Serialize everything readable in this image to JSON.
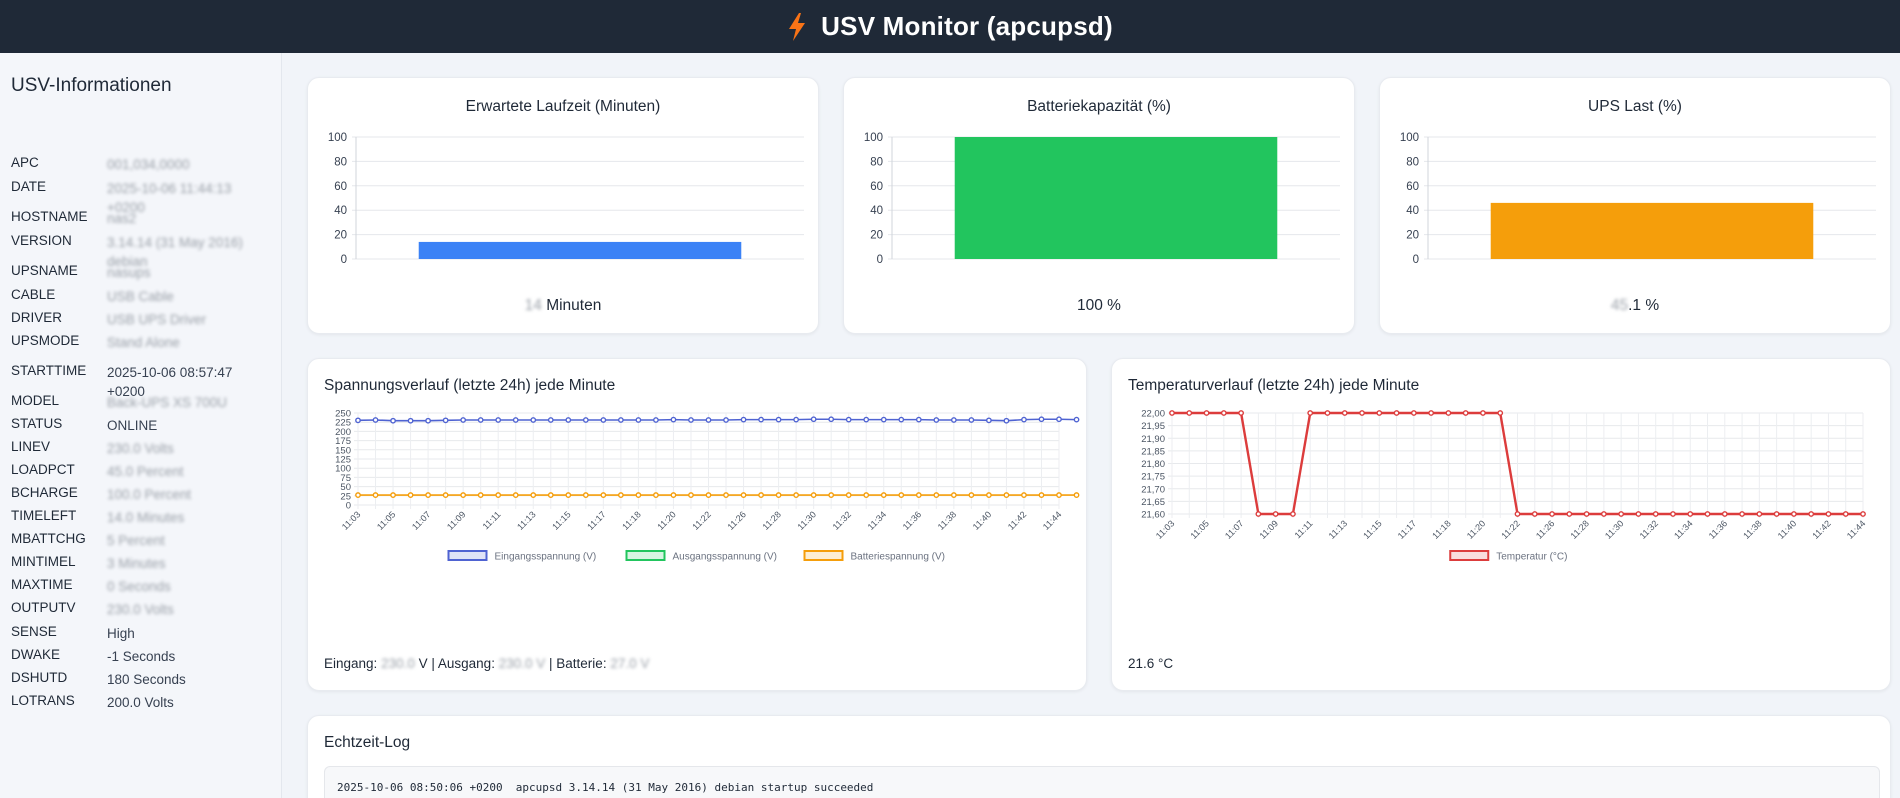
{
  "header": {
    "title": "USV Monitor (apcupsd)",
    "icon": "lightning-bolt-icon",
    "accent": "#f97316"
  },
  "sidebar": {
    "title": "USV-Informationen",
    "rows": [
      {
        "key": "APC",
        "value": "001,034,0000"
      },
      {
        "key": "DATE",
        "value": "2025-10-06 11:44:13 +0200",
        "blurred": true
      },
      {
        "key": "HOSTNAME",
        "value": "nas2"
      },
      {
        "key": "VERSION",
        "value": "3.14.14 (31 May 2016) debian",
        "blurred": true
      },
      {
        "key": "UPSNAME",
        "value": "nasups"
      },
      {
        "key": "CABLE",
        "value": "USB Cable"
      },
      {
        "key": "DRIVER",
        "value": "USB UPS Driver"
      },
      {
        "key": "UPSMODE",
        "value": "Stand Alone"
      },
      {
        "key": "STARTTIME",
        "value": "2025-10-06 08:57:47 +0200",
        "blurred": false
      },
      {
        "key": "MODEL",
        "value": "Back-UPS XS 700U"
      },
      {
        "key": "STATUS",
        "value": "ONLINE"
      },
      {
        "key": "LINEV",
        "value": "230.0 Volts"
      },
      {
        "key": "LOADPCT",
        "value": "45.0 Percent"
      },
      {
        "key": "BCHARGE",
        "value": "100.0 Percent"
      },
      {
        "key": "TIMELEFT",
        "value": "14.0 Minutes"
      },
      {
        "key": "MBATTCHG",
        "value": "5 Percent"
      },
      {
        "key": "MINTIMEL",
        "value": "3 Minutes"
      },
      {
        "key": "MAXTIME",
        "value": "0 Seconds"
      },
      {
        "key": "OUTPUTV",
        "value": "230.0 Volts"
      },
      {
        "key": "SENSE",
        "value": "High"
      },
      {
        "key": "DWAKE",
        "value": "-1 Seconds"
      },
      {
        "key": "DSHUTD",
        "value": "180 Seconds"
      },
      {
        "key": "LOTRANS",
        "value": "200.0 Volts"
      }
    ]
  },
  "cards": {
    "runtime": {
      "title": "Erwartete Laufzeit (Minuten)",
      "value_num": "14",
      "value_unit": "Minuten",
      "color": "#3b82f6"
    },
    "battery": {
      "title": "Batteriekapazität (%)",
      "value_text": "100 %",
      "color": "#22c55e"
    },
    "load": {
      "title": "UPS Last (%)",
      "value_num": "45",
      "value_unit": ".1 %",
      "color": "#f59e0b"
    },
    "voltage": {
      "title": "Spannungsverlauf (letzte 24h) jede Minute",
      "footer_prefix": "Eingang:",
      "eingang": "230.0",
      "footer_v": "V | Ausgang:",
      "ausgang": "230.0 V",
      "footer_b": "| Batterie:",
      "batterie": "27.0 V"
    },
    "temperature": {
      "title": "Temperaturverlauf (letzte 24h) jede Minute",
      "footer": "21.6 °C"
    },
    "log": {
      "title": "Echtzeit-Log",
      "line1": "2025-10-06 08:50:06 +0200  apcupsd 3.14.14 (31 May 2016) debian startup succeeded"
    }
  },
  "chart_data": [
    {
      "type": "bar",
      "categories": [
        ""
      ],
      "values": [
        14
      ],
      "title": "Erwartete Laufzeit (Minuten)",
      "ylim": [
        0,
        100
      ],
      "yticks": [
        "0",
        "20",
        "40",
        "60",
        "80",
        "100"
      ],
      "color": "#3b82f6"
    },
    {
      "type": "bar",
      "categories": [
        ""
      ],
      "values": [
        100
      ],
      "title": "Batteriekapazität (%)",
      "ylim": [
        0,
        100
      ],
      "yticks": [
        "0",
        "20",
        "40",
        "60",
        "80",
        "100"
      ],
      "color": "#22c55e"
    },
    {
      "type": "bar",
      "categories": [
        ""
      ],
      "values": [
        46
      ],
      "title": "UPS Last (%)",
      "ylim": [
        0,
        100
      ],
      "yticks": [
        "0",
        "20",
        "40",
        "60",
        "80",
        "100"
      ],
      "color": "#f59e0b"
    },
    {
      "type": "line",
      "title": "Spannungsverlauf (letzte 24h) jede Minute",
      "x": [
        "11:03",
        "11:04",
        "11:05",
        "11:06",
        "11:07",
        "11:08",
        "11:09",
        "11:10",
        "11:11",
        "11:12",
        "11:13",
        "11:14",
        "11:15",
        "11:16",
        "11:17",
        "11:18",
        "11:18",
        "11:19",
        "11:20",
        "11:21",
        "11:22",
        "11:23",
        "11:26",
        "11:27",
        "11:28",
        "11:29",
        "11:30",
        "11:31",
        "11:32",
        "11:33",
        "11:34",
        "11:35",
        "11:36",
        "11:37",
        "11:38",
        "11:39",
        "11:40",
        "11:41",
        "11:42",
        "11:43",
        "11:44"
      ],
      "xticks": [
        "11:03",
        "11:05",
        "11:07",
        "11:09",
        "11:11",
        "11:13",
        "11:15",
        "11:17",
        "11:18",
        "11:20",
        "11:22",
        "11:26",
        "11:28",
        "11:30",
        "11:32",
        "11:34",
        "11:36",
        "11:38",
        "11:40",
        "11:42",
        "11:44"
      ],
      "ylim": [
        0,
        250
      ],
      "yticks": [
        "0",
        "25",
        "50",
        "75",
        "100",
        "125",
        "150",
        "175",
        "200",
        "225",
        "250"
      ],
      "series": [
        {
          "name": "Eingangsspannung (V)",
          "color": "#4f63d2",
          "values": [
            230,
            231,
            229,
            229,
            229,
            230,
            231,
            231,
            231,
            231,
            231,
            231,
            231,
            231,
            231,
            231,
            231,
            231,
            232,
            231,
            231,
            231,
            232,
            232,
            232,
            232,
            233,
            233,
            232,
            232,
            232,
            232,
            232,
            231,
            231,
            231,
            230,
            229,
            232,
            233,
            233,
            232
          ]
        },
        {
          "name": "Ausgangsspannung (V)",
          "color": "#22c55e",
          "values": []
        },
        {
          "name": "Batteriespannung (V)",
          "color": "#f59e0b",
          "values": [
            27,
            27,
            27,
            27,
            27,
            27,
            27,
            27,
            27,
            27,
            27,
            27,
            27,
            27,
            27,
            27,
            27,
            27,
            27,
            27,
            27,
            27,
            27,
            27,
            27,
            27,
            27,
            27,
            27,
            27,
            27,
            27,
            27,
            27,
            27,
            27,
            27,
            27,
            27,
            27,
            27,
            27
          ]
        }
      ]
    },
    {
      "type": "line",
      "title": "Temperaturverlauf (letzte 24h) jede Minute",
      "x": [
        "11:03",
        "11:04",
        "11:05",
        "11:06",
        "11:07",
        "11:08",
        "11:09",
        "11:10",
        "11:11",
        "11:12",
        "11:13",
        "11:14",
        "11:15",
        "11:16",
        "11:17",
        "11:18",
        "11:18",
        "11:19",
        "11:20",
        "11:21",
        "11:22",
        "11:23",
        "11:26",
        "11:27",
        "11:28",
        "11:29",
        "11:30",
        "11:31",
        "11:32",
        "11:33",
        "11:34",
        "11:35",
        "11:36",
        "11:37",
        "11:38",
        "11:39",
        "11:40",
        "11:41",
        "11:42",
        "11:43",
        "11:44"
      ],
      "xticks": [
        "11:03",
        "11:05",
        "11:07",
        "11:09",
        "11:11",
        "11:13",
        "11:15",
        "11:17",
        "11:18",
        "11:20",
        "11:22",
        "11:26",
        "11:28",
        "11:30",
        "11:32",
        "11:34",
        "11:36",
        "11:38",
        "11:40",
        "11:42",
        "11:44"
      ],
      "ylim": [
        21.6,
        22.0
      ],
      "yticks": [
        "21,60",
        "21,65",
        "21,70",
        "21,75",
        "21,80",
        "21,85",
        "21,90",
        "21,95",
        "22,00"
      ],
      "series": [
        {
          "name": "Temperatur (°C)",
          "color": "#dc3c3c",
          "values": [
            22.0,
            22.0,
            22.0,
            22.0,
            22.0,
            21.6,
            21.6,
            21.6,
            22.0,
            22.0,
            22.0,
            22.0,
            22.0,
            22.0,
            22.0,
            22.0,
            22.0,
            22.0,
            22.0,
            22.0,
            21.6,
            21.6,
            21.6,
            21.6,
            21.6,
            21.6,
            21.6,
            21.6,
            21.6,
            21.6,
            21.6,
            21.6,
            21.6,
            21.6,
            21.6,
            21.6,
            21.6,
            21.6,
            21.6,
            21.6,
            21.6
          ]
        }
      ]
    }
  ]
}
